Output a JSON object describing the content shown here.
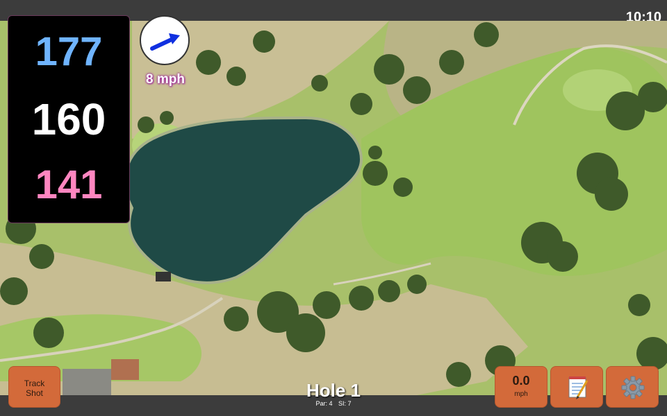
{
  "status": {
    "time": "10:10"
  },
  "distances": {
    "back": "177",
    "middle": "160",
    "front": "141"
  },
  "wind": {
    "speed": "8 mph",
    "icon": "wind-direction-arrow-icon",
    "arrow_color": "#1030e0"
  },
  "buttons": {
    "track_shot_line1": "Track",
    "track_shot_line2": "Shot",
    "speed_value": "0.0",
    "speed_unit": "mph",
    "notes_icon": "notepad-icon",
    "settings_icon": "gear-icon"
  },
  "hole": {
    "title": "Hole 1",
    "par": "Par: 4",
    "si": "SI: 7"
  },
  "colors": {
    "button": "#d36a3a",
    "back_distance": "#6fb4ff",
    "front_distance": "#ff86c0",
    "bar": "#3c3c3c"
  }
}
